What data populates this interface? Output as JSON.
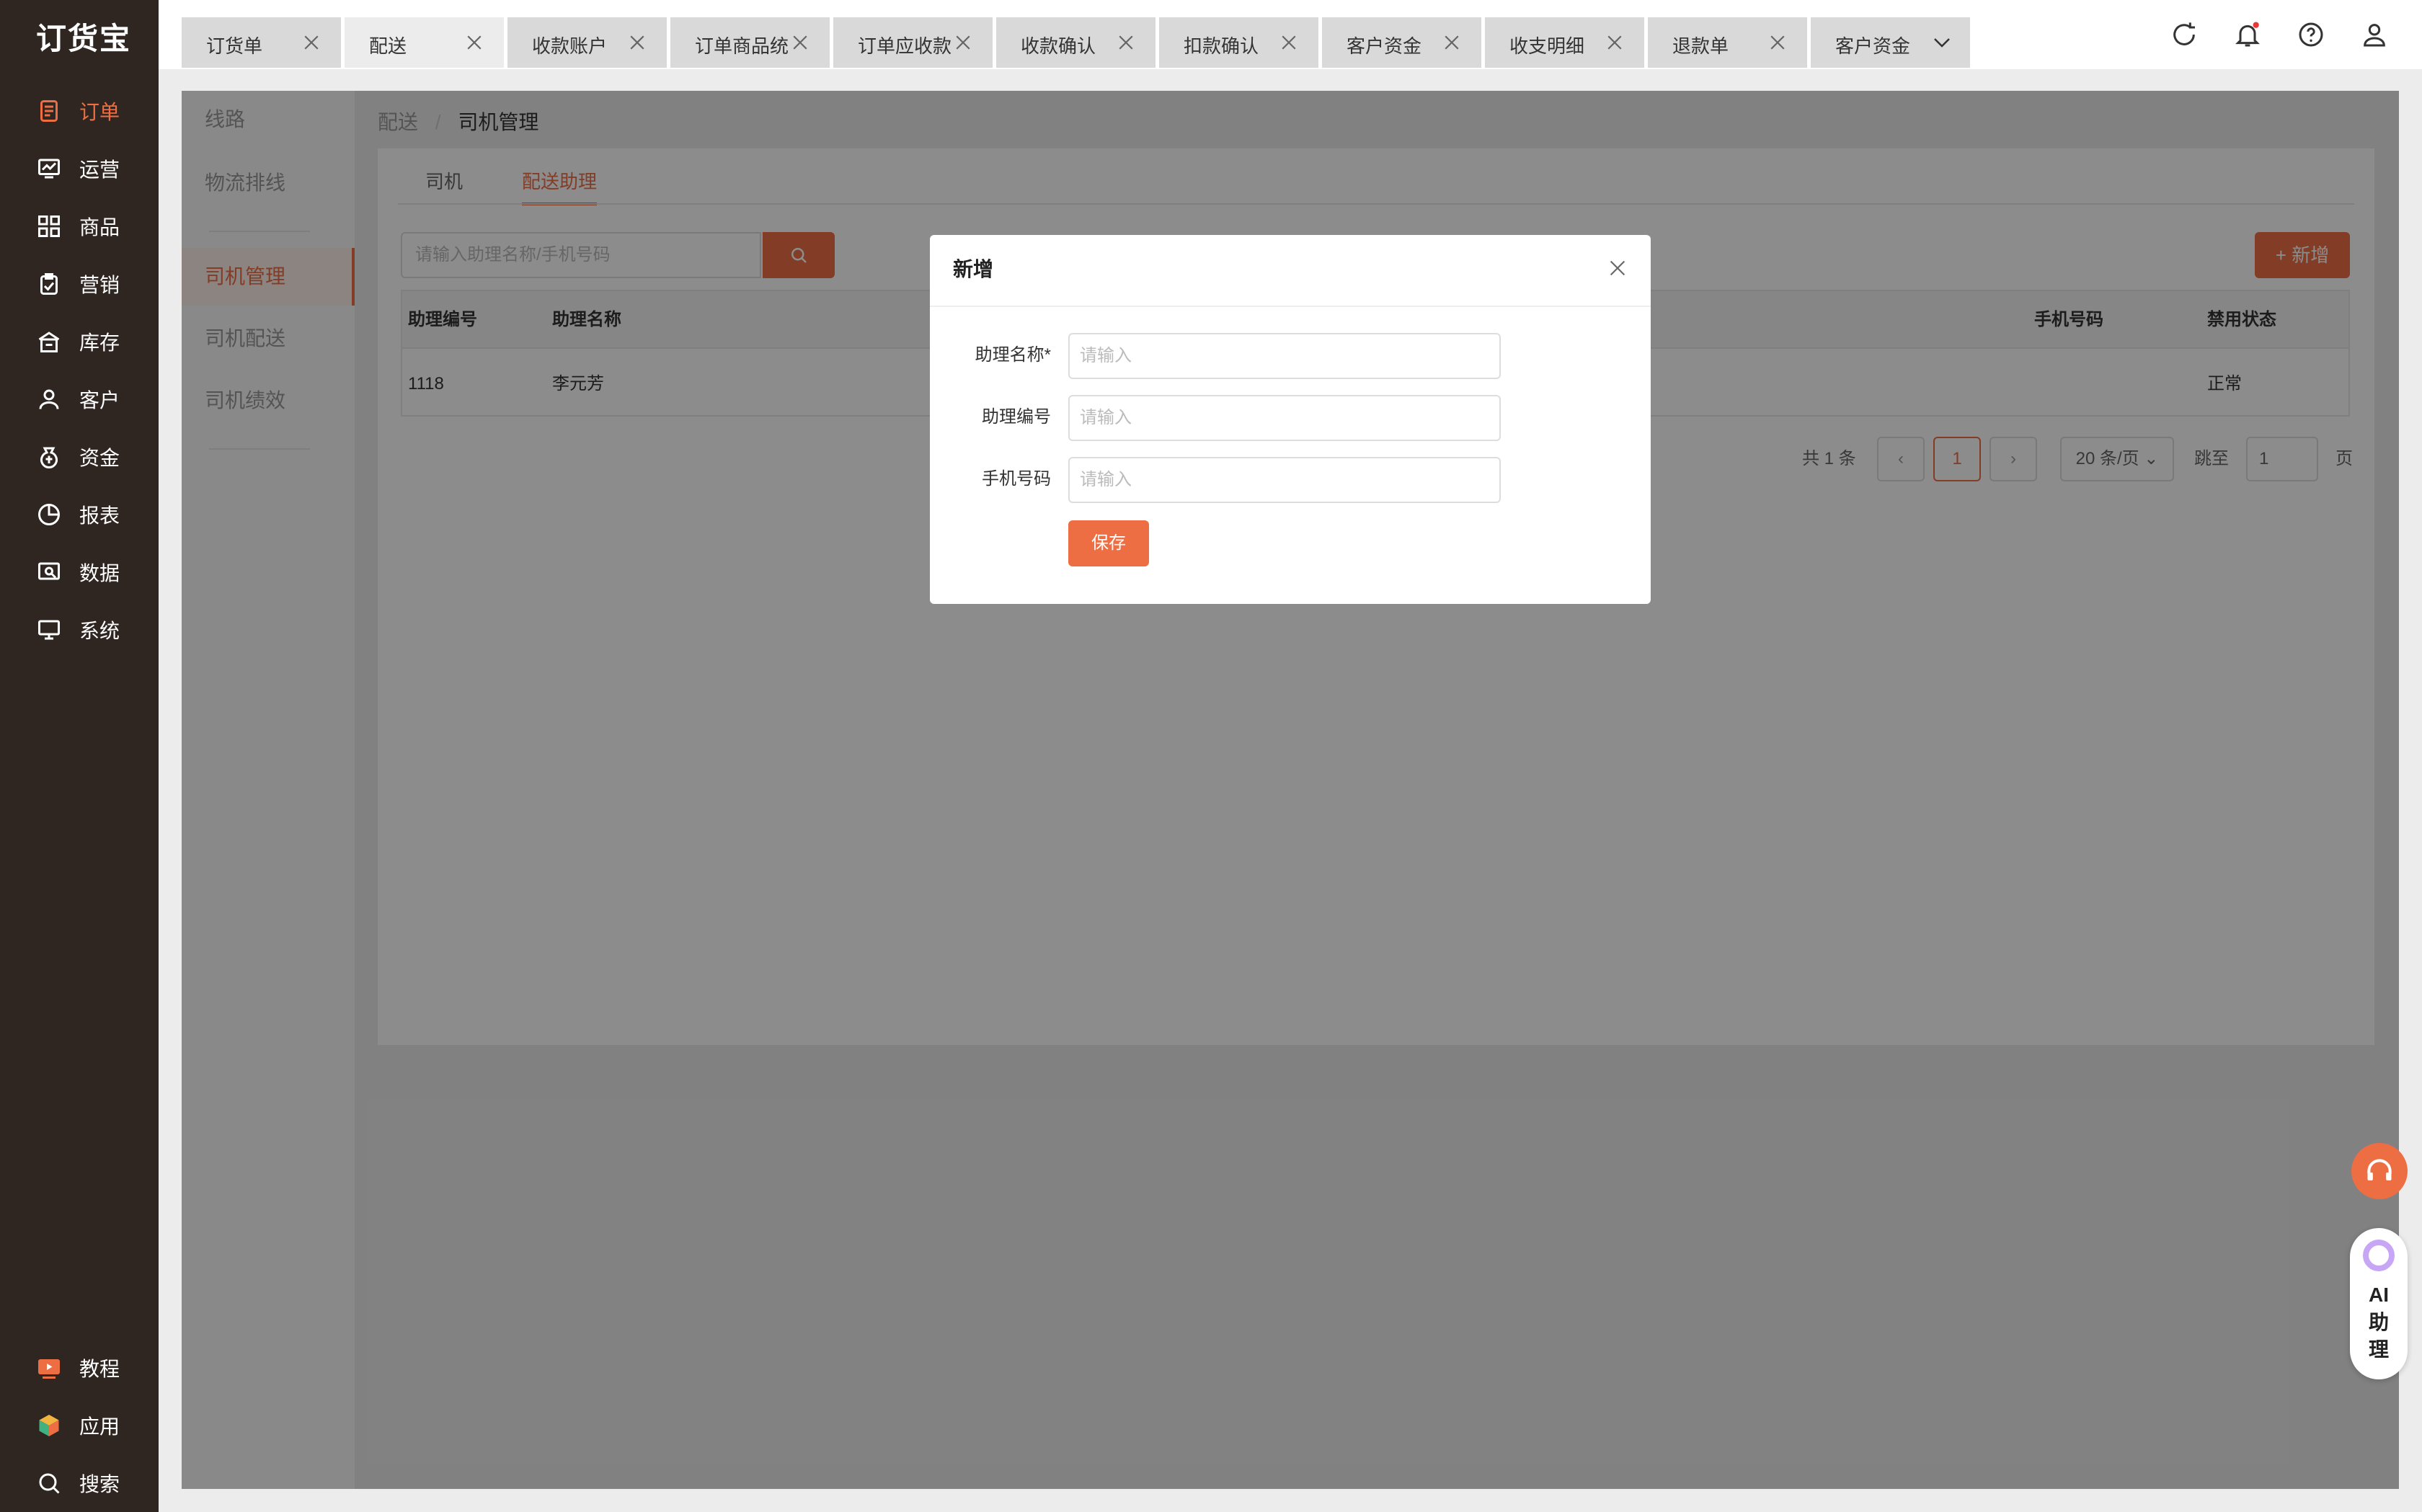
{
  "app": {
    "logo": "订货宝"
  },
  "leftnav": {
    "items": [
      {
        "label": "订单",
        "icon": "order-icon",
        "active": true
      },
      {
        "label": "运营",
        "icon": "operations-icon"
      },
      {
        "label": "商品",
        "icon": "products-icon"
      },
      {
        "label": "营销",
        "icon": "marketing-icon"
      },
      {
        "label": "库存",
        "icon": "warehouse-icon"
      },
      {
        "label": "客户",
        "icon": "customer-icon"
      },
      {
        "label": "资金",
        "icon": "money-bag-icon"
      },
      {
        "label": "报表",
        "icon": "pie-chart-icon"
      },
      {
        "label": "数据",
        "icon": "data-icon"
      },
      {
        "label": "系统",
        "icon": "monitor-icon"
      }
    ],
    "bottom": [
      {
        "label": "教程",
        "icon": "tutorial-icon"
      },
      {
        "label": "应用",
        "icon": "apps-cube-icon"
      },
      {
        "label": "搜索",
        "icon": "search-icon"
      }
    ]
  },
  "tabs": [
    {
      "label": "订货单"
    },
    {
      "label": "配送",
      "active": true
    },
    {
      "label": "收款账户"
    },
    {
      "label": "订单商品统"
    },
    {
      "label": "订单应收款"
    },
    {
      "label": "收款确认"
    },
    {
      "label": "扣款确认"
    },
    {
      "label": "客户资金"
    },
    {
      "label": "收支明细"
    },
    {
      "label": "退款单"
    },
    {
      "label": "客户资金"
    }
  ],
  "sidepanel": {
    "items": [
      "线路",
      "物流排线",
      "司机管理",
      "司机配送",
      "司机绩效"
    ],
    "active": "司机管理"
  },
  "breadcrumb": {
    "parent": "配送",
    "current": "司机管理"
  },
  "subtabs": [
    "司机",
    "配送助理"
  ],
  "search": {
    "placeholder": "请输入助理名称/手机号码"
  },
  "add_button": "+ 新增",
  "table": {
    "headers": [
      "助理编号",
      "助理名称",
      "手机号码",
      "禁用状态"
    ],
    "rows": [
      [
        "1118",
        "李元芳",
        "",
        "正常"
      ]
    ]
  },
  "pagination": {
    "total": "共 1 条",
    "page": "1",
    "page_size": "20 条/页",
    "jump_label": "跳至",
    "jump_value": "1",
    "page_unit": "页"
  },
  "modal": {
    "title": "新增",
    "fields": [
      {
        "label": "助理名称*",
        "placeholder": "请输入"
      },
      {
        "label": "助理编号",
        "placeholder": "请输入"
      },
      {
        "label": "手机号码",
        "placeholder": "请输入"
      }
    ],
    "save": "保存"
  },
  "ai": {
    "text": "AI助理"
  },
  "colors": {
    "accent": "#ee6e44",
    "nav_bg": "#2f2622"
  }
}
